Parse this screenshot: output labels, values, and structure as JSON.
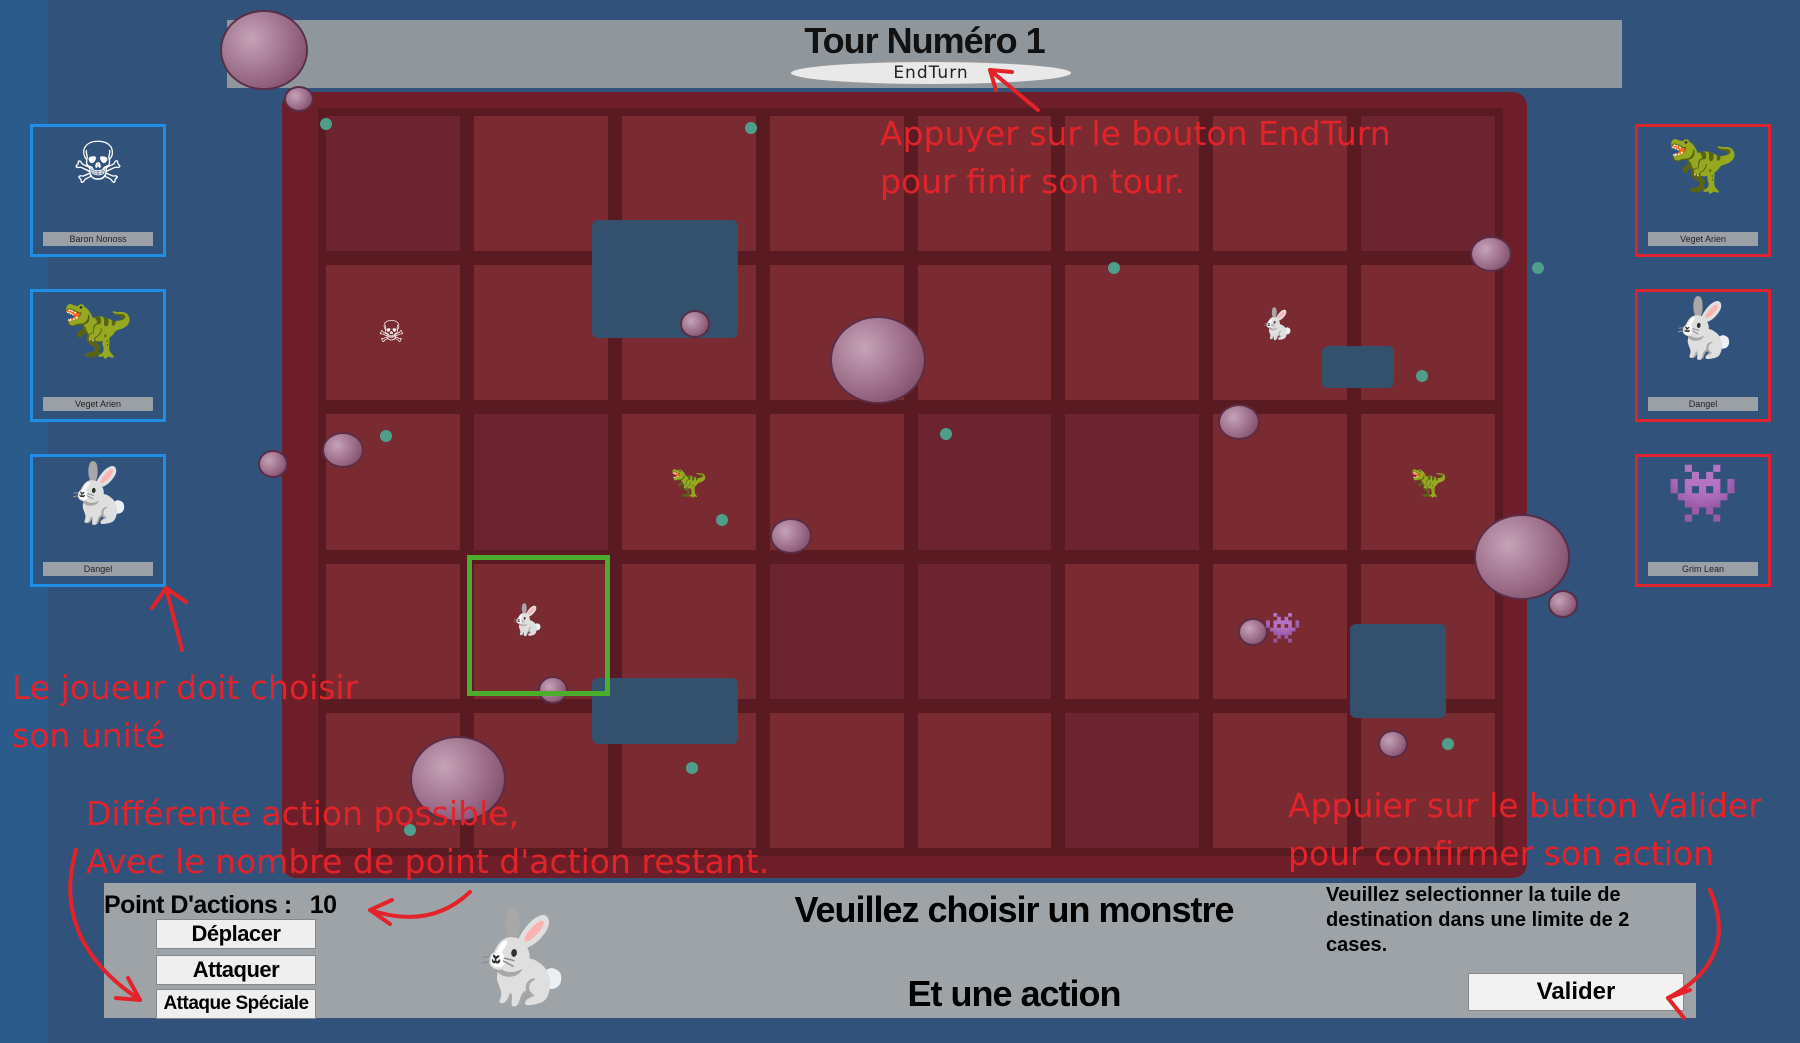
{
  "game": {
    "title": "Tour Numéro 1",
    "end_turn_label": "EndTurn"
  },
  "player_units": [
    {
      "name": "Baron Nonoss",
      "icon": "skeleton-icon",
      "glyph": "☠"
    },
    {
      "name": "Veget Arien",
      "icon": "dino-icon",
      "glyph": "🦖"
    },
    {
      "name": "Dangel",
      "icon": "creature-icon",
      "glyph": "🐇"
    }
  ],
  "enemy_units": [
    {
      "name": "Veget Arien",
      "icon": "dino-icon",
      "glyph": "🦖"
    },
    {
      "name": "Dangel",
      "icon": "creature-icon",
      "glyph": "🐇"
    },
    {
      "name": "Grim Lean",
      "icon": "monster-icon",
      "glyph": "👾"
    }
  ],
  "annotations": {
    "endturn": "Appuyer sur le bouton EndTurn\npour finir son tour.",
    "choose_unit": "Le joueur doit choisir\nson unité",
    "actions": "Différente action possible,\nAvec le nombre de point d'action restant.",
    "valider": "Appuier sur le button Valider\npour confirmer son action"
  },
  "panel": {
    "points_label": "Point D'actions :",
    "points_value": "10",
    "actions": [
      "Déplacer",
      "Attaquer",
      "Attaque Spéciale"
    ],
    "message_line1": "Veuillez choisir un monstre",
    "message_line2": "Et une action",
    "hint": "Veuillez selectionner la tuile de destination dans une limite de 2 cases.",
    "validate_label": "Valider"
  },
  "colors": {
    "player_border": "#1e8fe4",
    "enemy_border": "#e0212e",
    "selection": "#4cad2d",
    "annotation": "#e2232a"
  }
}
